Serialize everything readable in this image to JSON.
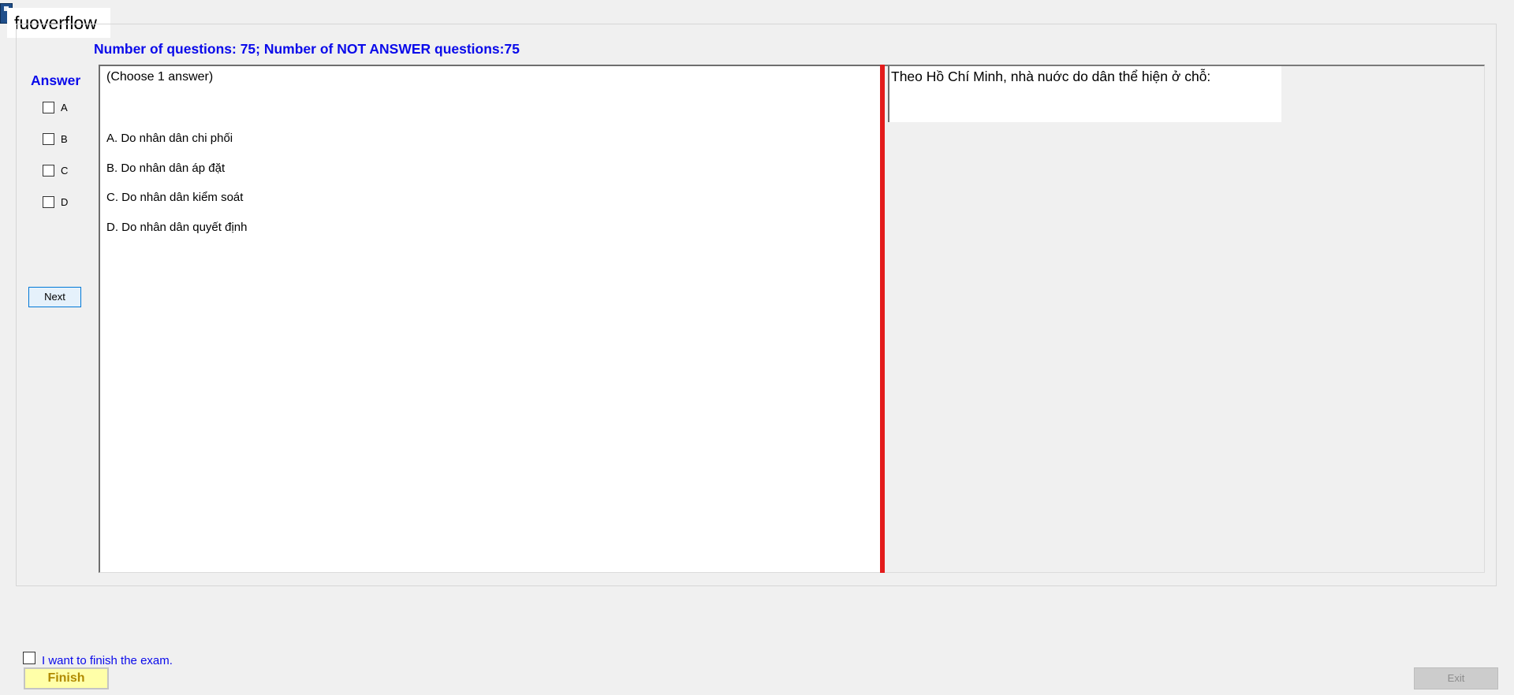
{
  "app": {
    "title": "fuoverflow",
    "icon": "app-icon"
  },
  "header": {
    "question_count_text": "Number of questions: 75; Number of NOT ANSWER questions:75"
  },
  "answer_panel": {
    "heading": "Answer",
    "options": [
      {
        "letter": "A",
        "checked": false
      },
      {
        "letter": "B",
        "checked": false
      },
      {
        "letter": "C",
        "checked": false
      },
      {
        "letter": "D",
        "checked": false
      }
    ],
    "next_label": "Next"
  },
  "answers_box": {
    "note": "(Choose 1 answer)",
    "choices": [
      "A.  Do nhân dân chi phối",
      "B.  Do nhân dân áp đặt",
      "C.  Do nhân dân kiểm soát",
      "D.  Do nhân dân quyết định"
    ]
  },
  "question": {
    "text": "Theo Hồ Chí Minh, nhà nuớc do dân thể hiện ở chỗ:"
  },
  "footer": {
    "finish_confirm_label": "I want to finish the exam.",
    "finish_confirm_checked": false,
    "finish_label": "Finish",
    "exit_label": "Exit"
  },
  "colors": {
    "accent_blue": "#0a0aea",
    "splitter_red": "#e31b1b",
    "finish_bg": "#ffffa8",
    "window_bg": "#f0f0f0"
  }
}
